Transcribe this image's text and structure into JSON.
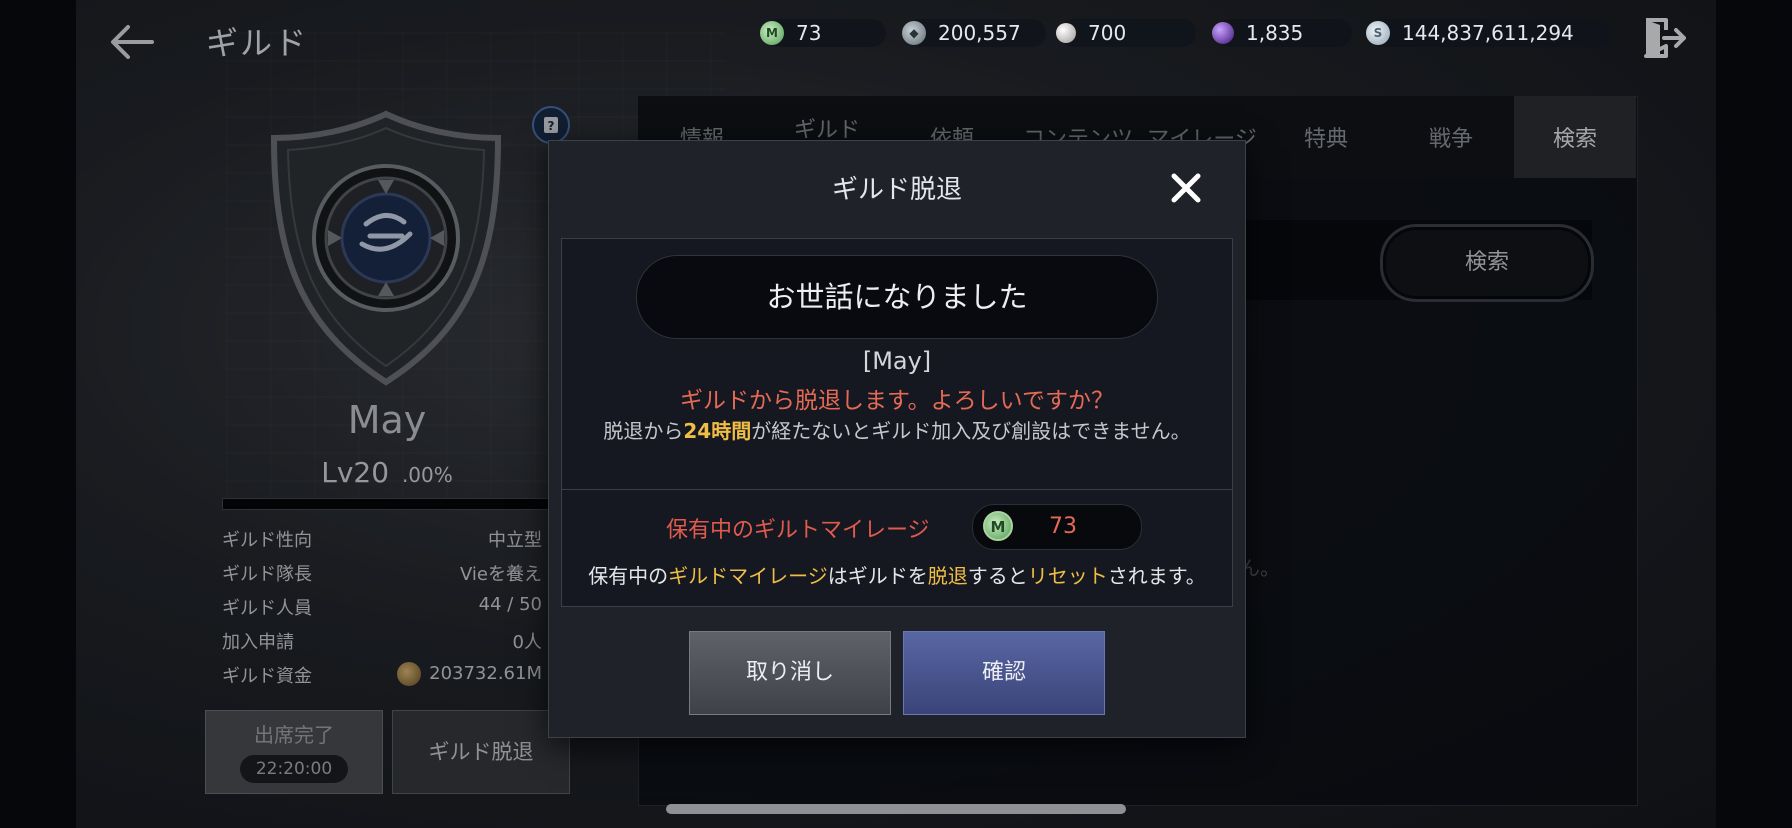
{
  "header": {
    "title": "ギルド",
    "currencies": [
      {
        "icon": "mileage-icon",
        "value": "73"
      },
      {
        "icon": "gem-icon",
        "value": "200,557"
      },
      {
        "icon": "pearl-icon",
        "value": "700"
      },
      {
        "icon": "purple-orb-icon",
        "value": "1,835"
      },
      {
        "icon": "silver-coin-icon",
        "value": "144,837,611,294"
      }
    ]
  },
  "guild": {
    "name": "May",
    "level": "Lv20",
    "level_pct": ".00%",
    "exp_progress": 0,
    "info": [
      {
        "key": "ギルド性向",
        "value": "中立型"
      },
      {
        "key": "ギルド隊長",
        "value": "Vieを養え"
      },
      {
        "key": "ギルド人員",
        "value": "44 / 50"
      },
      {
        "key": "加入申請",
        "value": "0人"
      },
      {
        "key": "ギルド資金",
        "value": "203732.61M"
      }
    ],
    "attendance_label": "出席完了",
    "attendance_timer": "22:20:00",
    "leave_button": "ギルド脱退"
  },
  "tabs": [
    {
      "label": "情報",
      "active": false
    },
    {
      "label": "ギルド",
      "active": false
    },
    {
      "label": "依頼",
      "active": false
    },
    {
      "label": "コンテンツ",
      "active": false
    },
    {
      "label": "マイレージ",
      "active": false
    },
    {
      "label": "特典",
      "active": false
    },
    {
      "label": "戦争",
      "active": false
    },
    {
      "label": "検索",
      "active": true
    }
  ],
  "search": {
    "button_label": "検索"
  },
  "background_hint": "ん。",
  "dialog": {
    "title": "ギルド脱退",
    "farewell": "お世話になりました",
    "player_name": "[May]",
    "confirm_text": "ギルドから脱退します。よろしいですか？",
    "note_prefix": "脱退から",
    "note_highlight": "24時間",
    "note_suffix": "が経たないとギルド加入及び創設はできません。",
    "mileage_label": "保有中のギルトマイレージ",
    "mileage_value": "73",
    "reset_parts": [
      "保有中の",
      "ギルドマイレージ",
      "はギルドを",
      "脱退",
      "すると",
      "リセット",
      "されます。"
    ],
    "cancel_label": "取り消し",
    "confirm_label": "確認"
  },
  "colors": {
    "warning": "#e46a55",
    "highlight": "#f0bd45",
    "confirm_button": "#4a559a"
  }
}
